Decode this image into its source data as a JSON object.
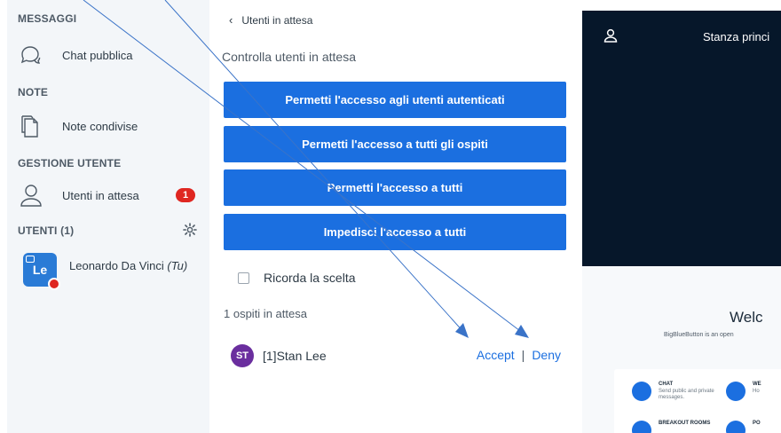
{
  "sidebar": {
    "messages_header": "MESSAGGI",
    "public_chat": "Chat pubblica",
    "notes_header": "NOTE",
    "shared_notes": "Note condivise",
    "user_mgmt_header": "GESTIONE UTENTE",
    "waiting_users": "Utenti in attesa",
    "waiting_badge": "1",
    "users_header": "UTENTI (1)",
    "current_user": {
      "avatar_initials": "Le",
      "name": "Leonardo Da Vinci",
      "you_tag": "(Tu)"
    }
  },
  "panel": {
    "back_label": "Utenti in attesa",
    "title": "Controlla utenti in attesa",
    "buttons": [
      "Permetti l'accesso agli utenti autenticati",
      "Permetti l'accesso a tutti gli ospiti",
      "Permetti l'accesso a tutti",
      "Impedisci l'accesso a tutti"
    ],
    "remember_label": "Ricorda la scelta",
    "waiting_count": "1 ospiti in attesa",
    "guest": {
      "initials": "ST",
      "name": "[1]Stan Lee",
      "accept": "Accept",
      "separator": "|",
      "deny": "Deny"
    }
  },
  "stage": {
    "room_title": "Stanza princi",
    "welcome": "Welc",
    "welcome_sub": "BigBlueButton is an open",
    "cards": [
      {
        "title": "CHAT",
        "desc": "Send public and private messages."
      },
      {
        "title": "WE",
        "desc": "Ho"
      },
      {
        "title": "BREAKOUT ROOMS",
        "desc": ""
      },
      {
        "title": "PO",
        "desc": ""
      }
    ]
  },
  "colors": {
    "primary": "#1b6fe0",
    "badge": "#df2721",
    "dark_bg": "#06172a",
    "guest_avatar": "#6a2e9e"
  }
}
